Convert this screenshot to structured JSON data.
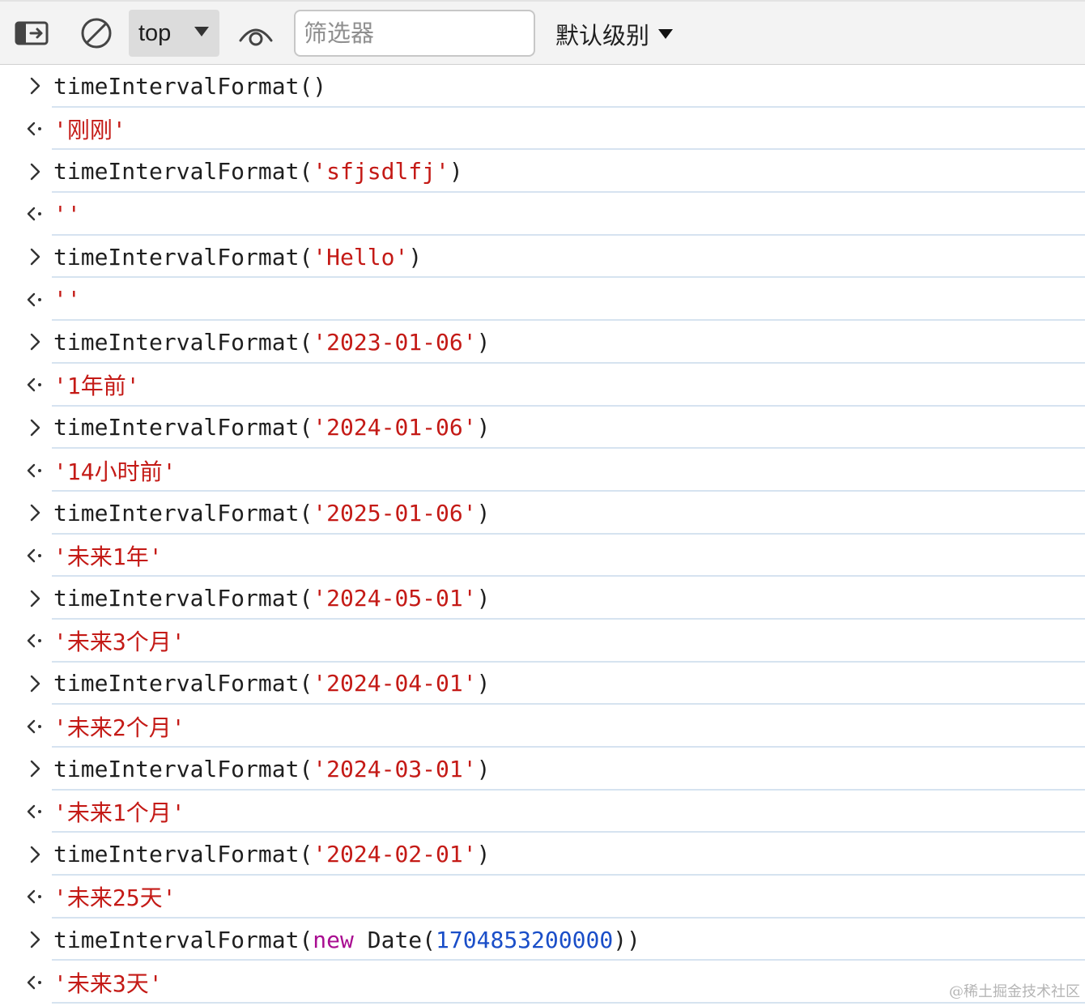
{
  "toolbar": {
    "sidebar_icon": "sidebar-toggle-icon",
    "clear_icon": "clear-console-icon",
    "context_value": "top",
    "eye_icon": "live-expression-icon",
    "filter_placeholder": "筛选器",
    "filter_value": "",
    "level_label": "默认级别"
  },
  "entries": [
    {
      "kind": "input",
      "fn": "timeIntervalFormat",
      "open": "(",
      "arg_str": "",
      "close": ")"
    },
    {
      "kind": "output",
      "value": "'刚刚'"
    },
    {
      "kind": "input",
      "fn": "timeIntervalFormat",
      "open": "(",
      "arg_str": "'sfjsdlfj'",
      "close": ")"
    },
    {
      "kind": "output",
      "value": "''"
    },
    {
      "kind": "input",
      "fn": "timeIntervalFormat",
      "open": "(",
      "arg_str": "'Hello'",
      "close": ")"
    },
    {
      "kind": "output",
      "value": "''"
    },
    {
      "kind": "input",
      "fn": "timeIntervalFormat",
      "open": "(",
      "arg_str": "'2023-01-06'",
      "close": ")"
    },
    {
      "kind": "output",
      "value": "'1年前'"
    },
    {
      "kind": "input",
      "fn": "timeIntervalFormat",
      "open": "(",
      "arg_str": "'2024-01-06'",
      "close": ")"
    },
    {
      "kind": "output",
      "value": "'14小时前'"
    },
    {
      "kind": "input",
      "fn": "timeIntervalFormat",
      "open": "(",
      "arg_str": "'2025-01-06'",
      "close": ")"
    },
    {
      "kind": "output",
      "value": "'未来1年'"
    },
    {
      "kind": "input",
      "fn": "timeIntervalFormat",
      "open": "(",
      "arg_str": "'2024-05-01'",
      "close": ")"
    },
    {
      "kind": "output",
      "value": "'未来3个月'"
    },
    {
      "kind": "input",
      "fn": "timeIntervalFormat",
      "open": "(",
      "arg_str": "'2024-04-01'",
      "close": ")"
    },
    {
      "kind": "output",
      "value": "'未来2个月'"
    },
    {
      "kind": "input",
      "fn": "timeIntervalFormat",
      "open": "(",
      "arg_str": "'2024-03-01'",
      "close": ")"
    },
    {
      "kind": "output",
      "value": "'未来1个月'"
    },
    {
      "kind": "input",
      "fn": "timeIntervalFormat",
      "open": "(",
      "arg_str": "'2024-02-01'",
      "close": ")"
    },
    {
      "kind": "output",
      "value": "'未来25天'"
    },
    {
      "kind": "input",
      "fn": "timeIntervalFormat",
      "open": "(",
      "kw": "new",
      "ctor": " Date(",
      "arg_num": "1704853200000",
      "close": "))"
    },
    {
      "kind": "output",
      "value": "'未来3天'"
    }
  ],
  "watermark": "@稀土掘金技术社区",
  "colors": {
    "string": "#c41a16",
    "keyword": "#a90d91",
    "number": "#1a4ec8",
    "separator": "#d6e3f0",
    "toolbar_bg": "#f3f3f3"
  }
}
